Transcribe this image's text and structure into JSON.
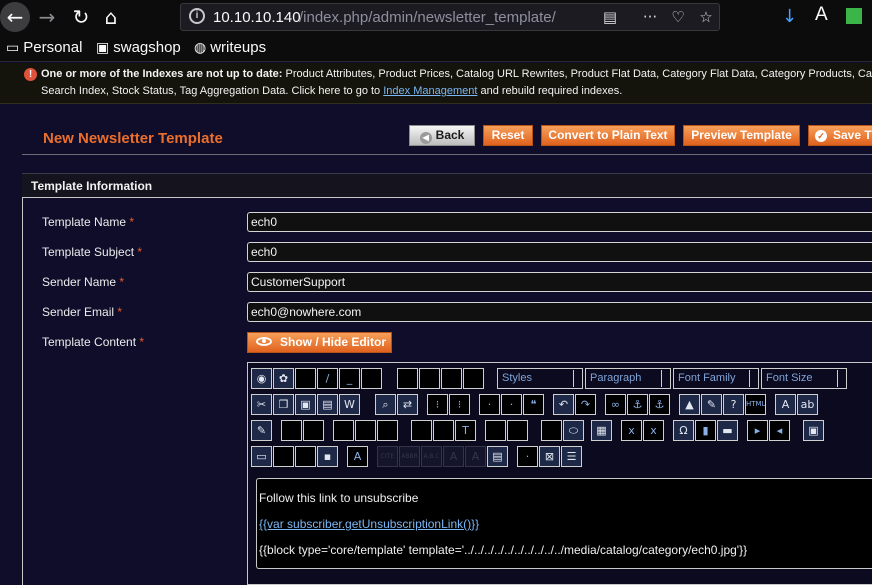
{
  "browser": {
    "url_host": "10.10.10.140",
    "url_path": "/index.php/admin/newsletter_template/",
    "bookmarks": [
      "Personal",
      "swagshop",
      "writeups"
    ],
    "icons": [
      "back-arrow-icon",
      "forward-arrow-icon",
      "reload-icon",
      "home-icon",
      "info-icon",
      "reader-view-icon",
      "more-icon",
      "pocket-icon",
      "star-icon",
      "download-icon",
      "font-icon",
      "extension-icon"
    ]
  },
  "notice": {
    "heading": "One or more of the Indexes are not up to date:",
    "line1": "Product Attributes, Product Prices, Catalog URL Rewrites, Product Flat Data, Category Flat Data, Category Products, Ca",
    "line2_prefix": "Search Index, Stock Status, Tag Aggregation Data. Click here to go to",
    "link": "Index Management",
    "line2_suffix": "and rebuild required indexes."
  },
  "page": {
    "title": "New Newsletter Template",
    "buttons": {
      "back": "Back",
      "reset": "Reset",
      "plain": "Convert to Plain Text",
      "preview": "Preview Template",
      "save": "Save T"
    }
  },
  "form": {
    "section_title": "Template Information",
    "required_mark": "*",
    "fields": {
      "name": {
        "label": "Template Name",
        "value": "ech0"
      },
      "subject": {
        "label": "Template Subject",
        "value": "ech0"
      },
      "sender_name": {
        "label": "Sender Name",
        "value": "CustomerSupport"
      },
      "sender_email": {
        "label": "Sender Email",
        "value": "ech0@nowhere.com"
      }
    },
    "content_label": "Template Content",
    "toggle_editor": "Show / Hide Editor"
  },
  "editor": {
    "selects": {
      "styles": "Styles",
      "paragraph": "Paragraph",
      "font_family": "Font Family",
      "font_size": "Font Size"
    },
    "content": {
      "line1": "Follow this link to unsubscribe",
      "line2": "{{var subscriber.getUnsubscriptionLink()}}",
      "line3": "{{block type='core/template' template='../../../../../../../../../../media/catalog/category/ech0.jpg'}}"
    }
  }
}
